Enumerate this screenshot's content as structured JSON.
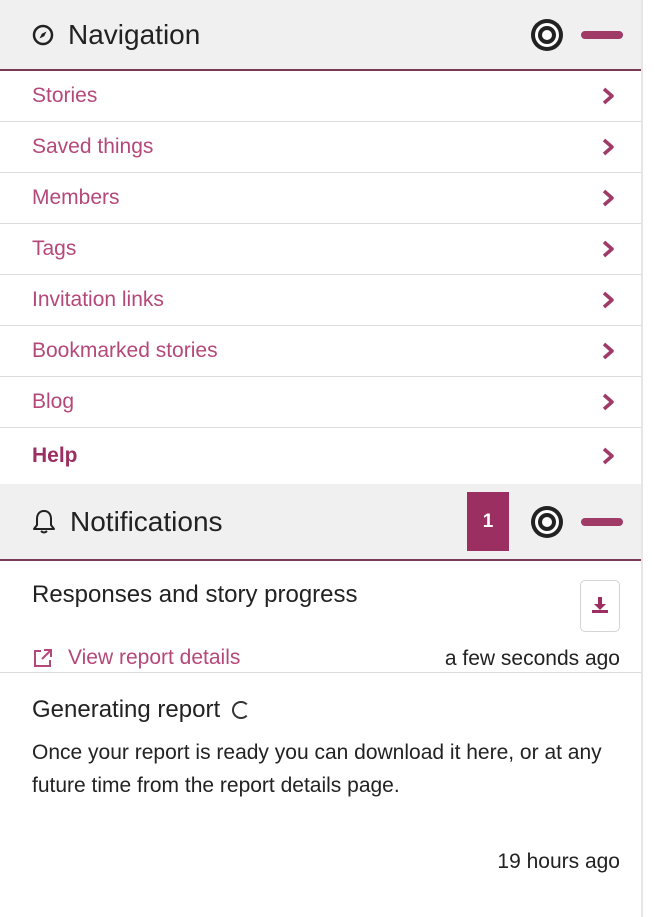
{
  "navigation": {
    "title": "Navigation",
    "icon": "compass-icon",
    "items": [
      {
        "label": "Stories",
        "bold": false
      },
      {
        "label": "Saved things",
        "bold": false
      },
      {
        "label": "Members",
        "bold": false
      },
      {
        "label": "Tags",
        "bold": false
      },
      {
        "label": "Invitation links",
        "bold": false
      },
      {
        "label": "Bookmarked stories",
        "bold": false
      },
      {
        "label": "Blog",
        "bold": false
      },
      {
        "label": "Help",
        "bold": true
      }
    ]
  },
  "notifications": {
    "title": "Notifications",
    "icon": "bell-icon",
    "badge_count": "1",
    "items": [
      {
        "title": "Responses and story progress",
        "link_label": "View report details",
        "timestamp": "a few seconds ago"
      },
      {
        "title": "Generating report",
        "body": "Once your report is ready you can download it here, or at any future time from the report details page.",
        "timestamp": "19 hours ago"
      }
    ]
  },
  "colors": {
    "accent": "#9c2f61",
    "link": "#b5487a",
    "header_bg": "#f1f0f1",
    "divider": "#7b3857"
  }
}
